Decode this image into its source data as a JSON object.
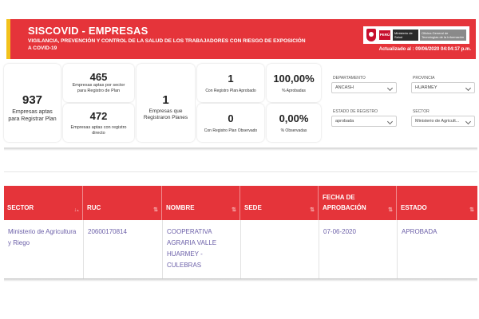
{
  "header": {
    "title": "SISCOVID - EMPRESAS",
    "subtitle": "VIGILANCIA, PREVENCIÓN Y CONTROL DE LA SALUD DE LOS TRABAJADORES CON RIESGO DE EXPOSICIÓN A COVID-19",
    "updated": "Actualizado al : 09/06/2020 04:04:17 p.m.",
    "logo": {
      "peru": "PERÚ",
      "ministry": "Ministerio de Salud",
      "office": "Oficina General de Tecnologías de la Información"
    }
  },
  "cards": {
    "aptas_registrar": {
      "value": "937",
      "label": "Empresas aptas para Registrar Plan"
    },
    "aptas_sector": {
      "value": "465",
      "label": "Empresas aptas por sector para Registro de Plan"
    },
    "aptas_directo": {
      "value": "472",
      "label": "Empresas aptas con registro directo"
    },
    "registraron": {
      "value": "1",
      "label": "Empresas que Registraron Planes"
    },
    "aprobado": {
      "value": "1",
      "label": "Con Registro Plan Aprobado"
    },
    "observado": {
      "value": "0",
      "label": "Con Registro Plan Observado"
    },
    "pct_aprobadas": {
      "value": "100,00%",
      "label": "% Aprobadas"
    },
    "pct_observadas": {
      "value": "0,00%",
      "label": "% Observadas"
    }
  },
  "filters": {
    "departamento": {
      "label": "DEPARTAMENTO",
      "value": "ANCASH"
    },
    "provincia": {
      "label": "PROVINCIA",
      "value": "HUARMEY"
    },
    "estado": {
      "label": "ESTADO DE REGISTRO",
      "value": "aprobada"
    },
    "sector": {
      "label": "SECTOR",
      "value": "Ministerio de Agricult..."
    }
  },
  "table": {
    "columns": [
      "SECTOR",
      "RUC",
      "NOMBRE",
      "SEDE",
      "FECHA DE APROBACIÓN",
      "ESTADO"
    ],
    "rows": [
      {
        "sector": "Ministerio de Agricultura y Riego",
        "ruc": "20600170814",
        "nombre": "COOPERATIVA AGRARIA VALLE HUARMEY - CULEBRAS",
        "sede": "",
        "fecha": "07-06-2020",
        "estado": "APROBADA"
      }
    ]
  },
  "colors": {
    "accent_red": "#e5343a",
    "accent_yellow": "#f2c21b",
    "row_text": "#6b5fa8"
  }
}
